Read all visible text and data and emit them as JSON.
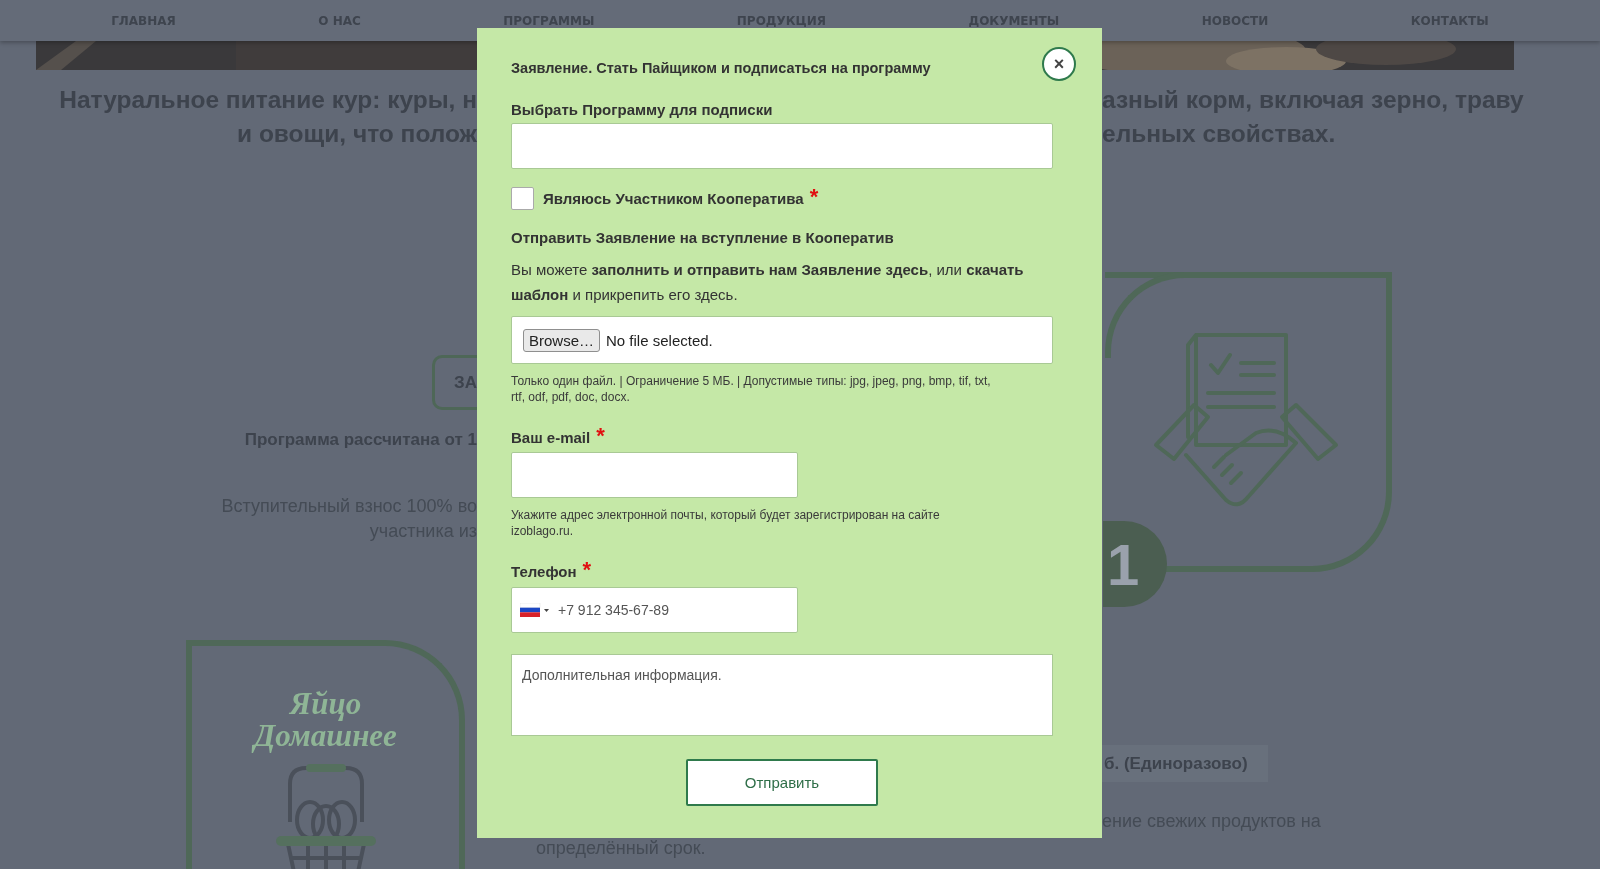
{
  "nav": [
    {
      "label": "ГЛАВНАЯ"
    },
    {
      "label": "О НАС"
    },
    {
      "label": "ПРОГРАММЫ"
    },
    {
      "label": "ПРОДУКЦИЯ"
    },
    {
      "label": "ДОКУМЕНТЫ"
    },
    {
      "label": "НОВОСТИ"
    },
    {
      "label": "КОНТАКТЫ"
    }
  ],
  "background": {
    "headline_left": [
      "Натуральное питание кур: куры, н",
      "и овощи, что полож"
    ],
    "headline_right": [
      "азный корм, включая зерно, траву",
      "ельных свойствах."
    ],
    "left_column": {
      "button": "ЗА",
      "title": "Программа рассчитана от 1",
      "text": [
        "Вступительный взнос 100% во",
        "участника из"
      ],
      "logo": [
        "Яйцо",
        "Домашнее"
      ]
    },
    "right_column": {
      "badge": "1",
      "tag": "б. (Единоразово)",
      "text": "ение свежих продуктов на"
    },
    "center_text": "определённый срок."
  },
  "modal": {
    "title": "Заявление. Стать Пайщиком и подписаться на программу",
    "close": "×",
    "program_label": "Выбрать Программу для подписки",
    "member_checkbox": {
      "label": "Являюсь Участником Кооператива",
      "required_mark": "*",
      "checked": false
    },
    "section_title": "Отправить Заявление на вступление в Кооператив",
    "paragraph": "Вы можете **заполнить и отправить нам Заявление здесь**, или **скачать шаблон** и прикрепить его здесь.",
    "file": {
      "button": "Browse…",
      "status": "No file selected.",
      "hint": "Только один файл. | Ограничение 5 МБ. | Допустимые типы: jpg, jpeg, png, bmp, tif, txt, rtf, odf, pdf, doc, docx."
    },
    "email": {
      "label": "Ваш e-mail",
      "required_mark": "*",
      "hint": "Укажите адрес электронной почты, который будет зарегистрирован на сайте izoblago.ru."
    },
    "phone": {
      "label": "Телефон",
      "required_mark": "*",
      "placeholder": "+7 912 345-67-89"
    },
    "comment": {
      "placeholder": "Дополнительная информация."
    },
    "submit": "Отправить"
  }
}
